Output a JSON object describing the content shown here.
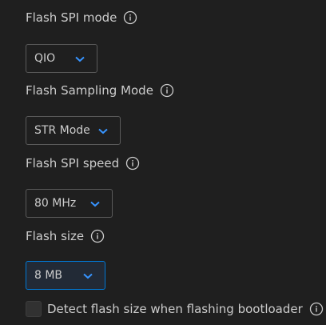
{
  "flash_spi_mode": {
    "label": "Flash SPI mode",
    "value": "QIO"
  },
  "flash_sampling_mode": {
    "label": "Flash Sampling Mode",
    "value": "STR Mode"
  },
  "flash_spi_speed": {
    "label": "Flash SPI speed",
    "value": "80 MHz"
  },
  "flash_size": {
    "label": "Flash size",
    "value": "8 MB"
  },
  "detect_flash_size": {
    "label": "Detect flash size when flashing bootloader",
    "checked": false
  },
  "colors": {
    "background": "#1f1f1f",
    "text": "#cccccc",
    "chevron": "#3794ff",
    "focus": "#0078d4"
  },
  "icons": {
    "info": "info-icon",
    "chevron": "chevron-down-icon"
  }
}
